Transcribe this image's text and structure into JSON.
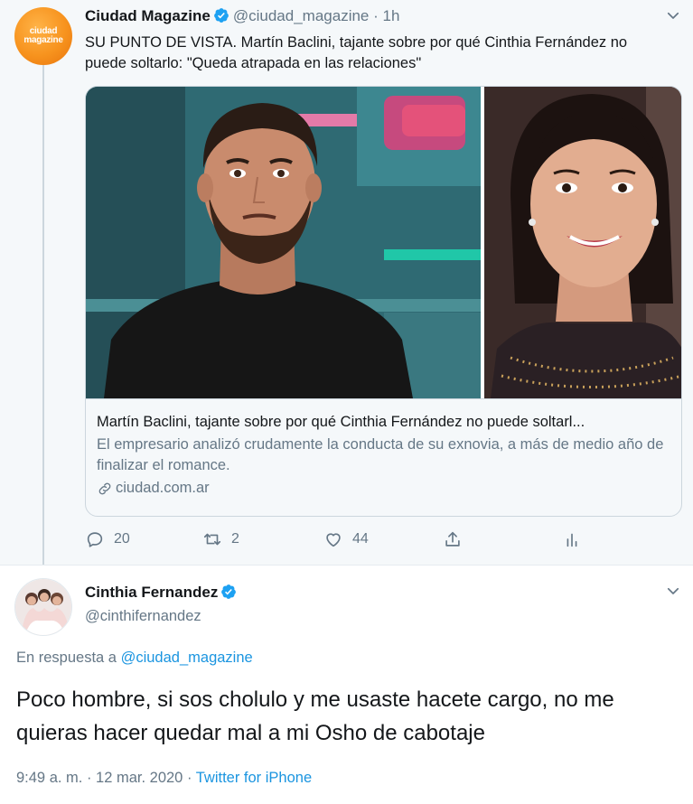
{
  "tweets": [
    {
      "author_name": "Ciudad Magazine",
      "author_handle": "@ciudad_magazine",
      "time": "1h",
      "avatar_text_line1": "ciudad",
      "avatar_text_line2": "magazine",
      "text": "SU PUNTO DE VISTA. Martín Baclini, tajante sobre por qué Cinthia Fernández no puede soltarlo: \"Queda atrapada en las relaciones\"",
      "card": {
        "title": "Martín Baclini, tajante sobre por qué Cinthia Fernández no puede soltarl...",
        "description": "El empresario analizó crudamente la conducta de su exnovia, a más de medio año de finalizar el romance.",
        "domain": "ciudad.com.ar"
      },
      "actions": {
        "replies": "20",
        "retweets": "2",
        "likes": "44"
      }
    },
    {
      "author_name": "Cinthia Fernandez",
      "author_handle": "@cinthifernandez",
      "reply_prefix": "En respuesta a",
      "reply_to": "@ciudad_magazine",
      "text": "Poco hombre, si sos cholulo y me usaste hacete cargo, no me quieras hacer quedar mal a mi Osho de cabotaje",
      "timestamp": "9:49 a. m. · 12 mar. 2020",
      "separator": " · ",
      "source": "Twitter for iPhone"
    }
  ],
  "colors": {
    "accent": "#1b95e0",
    "verified": "#1da1f2",
    "secondary_text": "#657786",
    "thread_bg": "#f5f8fa"
  },
  "icons": [
    "verified-badge-icon",
    "chevron-down-icon",
    "link-icon",
    "reply-icon",
    "retweet-icon",
    "like-icon",
    "share-icon",
    "analytics-icon"
  ]
}
